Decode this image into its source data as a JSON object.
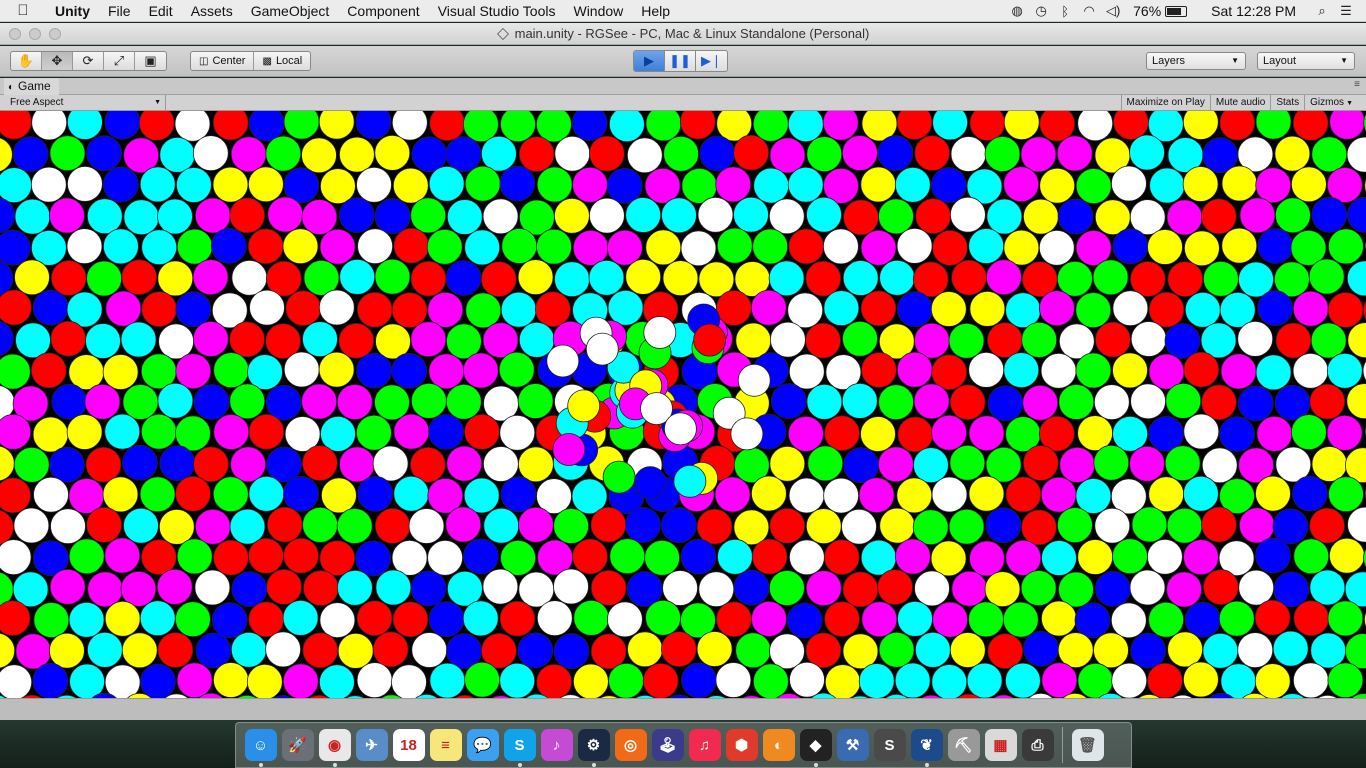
{
  "menubar": {
    "apple_icon": "apple-icon",
    "app_name": "Unity",
    "items": [
      "File",
      "Edit",
      "Assets",
      "GameObject",
      "Component",
      "Visual Studio Tools",
      "Window",
      "Help"
    ],
    "status_icons": [
      "creative-cloud-icon",
      "time-machine-icon",
      "bluetooth-icon",
      "wifi-icon",
      "volume-icon"
    ],
    "battery_percent": "76%",
    "battery_level": 0.76,
    "clock": "Sat 12:28 PM",
    "search_icon": "spotlight-icon",
    "notification_icon": "notification-center-icon"
  },
  "window": {
    "title": "main.unity - RGSee - PC, Mac & Linux Standalone (Personal)"
  },
  "toolbar": {
    "tools": [
      {
        "name": "hand-tool",
        "glyph": "✋"
      },
      {
        "name": "move-tool",
        "glyph": "✥"
      },
      {
        "name": "rotate-tool",
        "glyph": "⟳"
      },
      {
        "name": "scale-tool",
        "glyph": "⤢"
      },
      {
        "name": "rect-tool",
        "glyph": "▣"
      }
    ],
    "active_tool": "move-tool",
    "pivot_label": "Center",
    "space_label": "Local",
    "play_state": "playing",
    "layers_label": "Layers",
    "layout_label": "Layout"
  },
  "game_panel": {
    "tab_label": "Game",
    "aspect_label": "Free Aspect",
    "toggles": [
      "Maximize on Play",
      "Mute audio",
      "Stats",
      "Gizmos"
    ]
  },
  "scene": {
    "palette": [
      "#ff0000",
      "#00ff00",
      "#0000ff",
      "#ffff00",
      "#00ffff",
      "#ff00ff",
      "#ffffff"
    ]
  },
  "dock": {
    "apps": [
      {
        "name": "finder",
        "color": "#2a8fe8",
        "glyph": "☺",
        "running": true
      },
      {
        "name": "launchpad",
        "color": "#6a6f78",
        "glyph": "🚀",
        "running": false
      },
      {
        "name": "chrome",
        "color": "#e8e8e8",
        "glyph": "◉",
        "running": true
      },
      {
        "name": "preview",
        "color": "#5a8cc8",
        "glyph": "✈",
        "running": false
      },
      {
        "name": "calendar",
        "color": "#ffffff",
        "glyph": "18",
        "running": false
      },
      {
        "name": "notes",
        "color": "#f7e77a",
        "glyph": "≡",
        "running": false
      },
      {
        "name": "messages",
        "color": "#3aa0f2",
        "glyph": "💬",
        "running": false
      },
      {
        "name": "skype",
        "color": "#11a3ea",
        "glyph": "S",
        "running": true
      },
      {
        "name": "itunes-alt",
        "color": "#c54bd4",
        "glyph": "♪",
        "running": false
      },
      {
        "name": "steam",
        "color": "#1b2a42",
        "glyph": "⚙",
        "running": true
      },
      {
        "name": "origin",
        "color": "#f06a18",
        "glyph": "◎",
        "running": false
      },
      {
        "name": "joystick",
        "color": "#3b3b8a",
        "glyph": "🕹",
        "running": false
      },
      {
        "name": "itunes",
        "color": "#f22a4f",
        "glyph": "♫",
        "running": false
      },
      {
        "name": "sketchup",
        "color": "#e03a2a",
        "glyph": "⬢",
        "running": false
      },
      {
        "name": "blender",
        "color": "#f08a20",
        "glyph": "◐",
        "running": false
      },
      {
        "name": "unity",
        "color": "#222222",
        "glyph": "◆",
        "running": true
      },
      {
        "name": "xcode",
        "color": "#3a6ab0",
        "glyph": "⚒",
        "running": false
      },
      {
        "name": "sublime-text",
        "color": "#4a4a4a",
        "glyph": "S",
        "running": false
      },
      {
        "name": "sourcetree",
        "color": "#1d4a8a",
        "glyph": "❦",
        "running": true
      },
      {
        "name": "automator",
        "color": "#999999",
        "glyph": "⛏",
        "running": false
      },
      {
        "name": "calculator",
        "color": "#d9d9d9",
        "glyph": "▦",
        "running": false
      },
      {
        "name": "printer",
        "color": "#3a3a3a",
        "glyph": "⎙",
        "running": false
      }
    ],
    "trash": {
      "name": "trash",
      "color": "#dfe6ea",
      "glyph": "🗑"
    }
  }
}
